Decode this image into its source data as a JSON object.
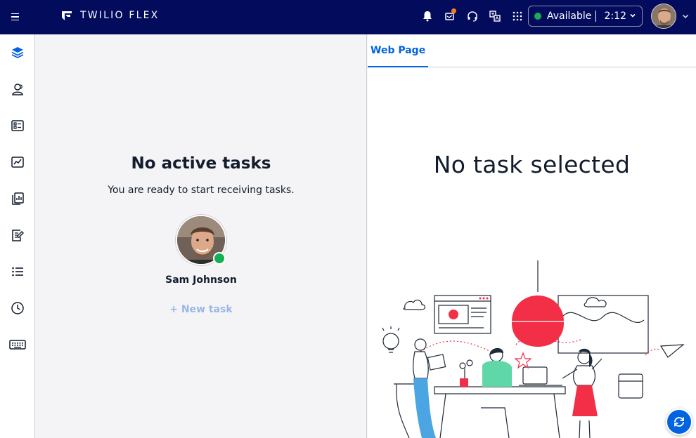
{
  "header": {
    "brand": "TWILIO FLEX",
    "status": {
      "label": "Available",
      "time": "2:12",
      "color": "#14b053"
    },
    "icons": [
      "notifications-icon",
      "inbox-icon",
      "headset-icon",
      "translate-icon",
      "apps-grid-icon"
    ]
  },
  "sidebar": {
    "items": [
      {
        "name": "layers-icon",
        "active": true
      },
      {
        "name": "teams-icon"
      },
      {
        "name": "queues-icon"
      },
      {
        "name": "insights-icon"
      },
      {
        "name": "reports-icon"
      },
      {
        "name": "edit-document-icon"
      },
      {
        "name": "list-icon"
      },
      {
        "name": "history-clock-icon"
      },
      {
        "name": "keyboard-icon"
      }
    ]
  },
  "left_panel": {
    "title": "No active tasks",
    "subtitle": "You are ready to start receiving tasks.",
    "agent_name": "Sam Johnson",
    "new_task_label": "+ New task"
  },
  "right_panel": {
    "tab_label": "Web Page",
    "empty_title": "No task selected"
  },
  "colors": {
    "topbar": "#030b5d",
    "accent": "#0263e0",
    "available": "#14b053",
    "illustration_red": "#f22f46",
    "illustration_blue": "#4ba5e3",
    "illustration_green": "#5fd7a8"
  }
}
